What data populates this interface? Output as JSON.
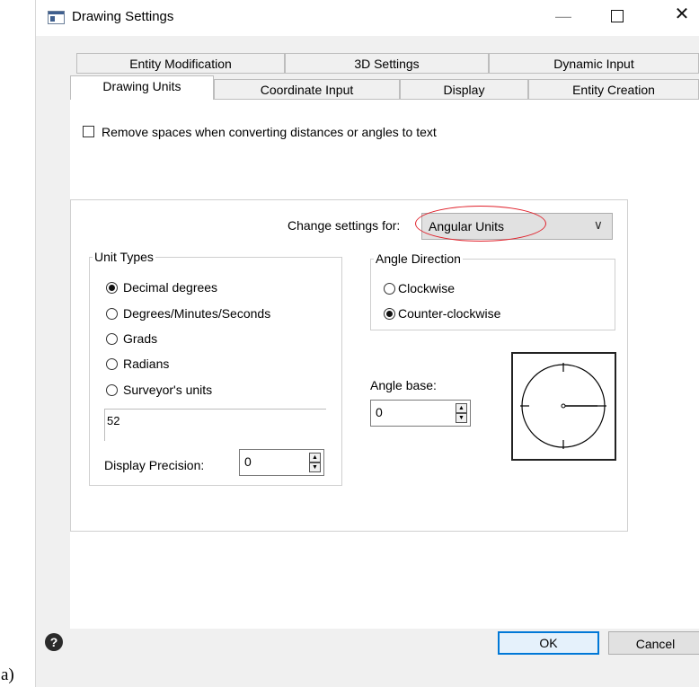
{
  "window": {
    "title": "Drawing Settings",
    "minimize_glyph": "—",
    "close_glyph": "✕"
  },
  "tabs": {
    "back_row": [
      "Entity Modification",
      "3D Settings",
      "Dynamic Input"
    ],
    "front_row": [
      "Drawing Units",
      "Coordinate Input",
      "Display",
      "Entity Creation"
    ],
    "selected": "Drawing Units"
  },
  "remove_spaces": {
    "label": "Remove spaces when converting distances or angles to text",
    "checked": false
  },
  "change_settings": {
    "label": "Change settings for:",
    "value": "Angular Units",
    "arrow": "∨",
    "highlight_color": "#e0202a"
  },
  "unit_types": {
    "title": "Unit Types",
    "options": [
      {
        "label": "Decimal degrees",
        "selected": true
      },
      {
        "label": "Degrees/Minutes/Seconds",
        "selected": false
      },
      {
        "label": "Grads",
        "selected": false
      },
      {
        "label": "Radians",
        "selected": false
      },
      {
        "label": "Surveyor's units",
        "selected": false
      }
    ],
    "surveyor_value": "52",
    "display_precision_label": "Display Precision:",
    "display_precision_value": "0"
  },
  "angle_direction": {
    "title": "Angle Direction",
    "options": [
      {
        "label": "Clockwise",
        "selected": false
      },
      {
        "label": "Counter-clockwise",
        "selected": true
      }
    ]
  },
  "angle_base": {
    "label": "Angle base:",
    "value": "0"
  },
  "footer": {
    "help_glyph": "?",
    "ok_label": "OK",
    "cancel_label": "Cancel",
    "corner_label": "a)"
  },
  "colors": {
    "accent": "#0078d7",
    "dialog_bg": "#f0f0f0"
  }
}
